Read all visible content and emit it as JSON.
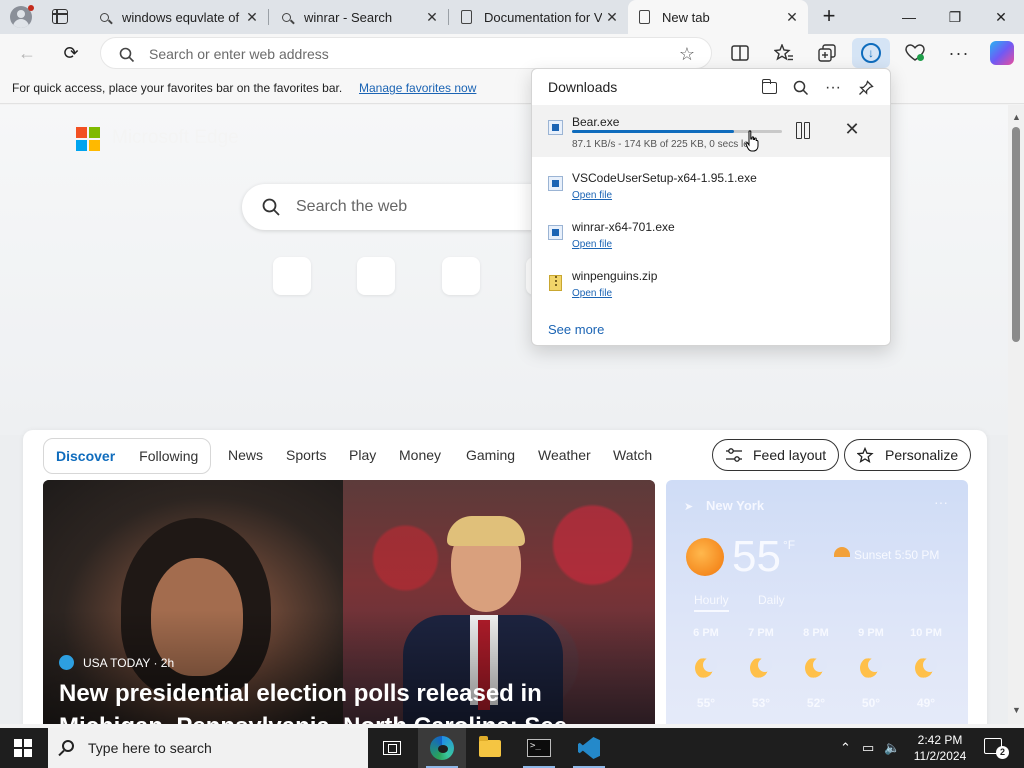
{
  "browser": {
    "tabs": [
      {
        "title": "windows equvlate of b",
        "icon": "search-icon"
      },
      {
        "title": "winrar - Search",
        "icon": "search-icon"
      },
      {
        "title": "Documentation for Vi",
        "icon": "document-icon"
      },
      {
        "title": "New tab",
        "icon": "document-icon",
        "active": true
      }
    ],
    "new_tab": "+",
    "close_glyph": "✕",
    "window": {
      "minimize": "—",
      "restore": "❐",
      "close": "✕"
    }
  },
  "address_bar": {
    "placeholder": "Search or enter web address",
    "value": ""
  },
  "favorites_bar": {
    "message": "For quick access, place your favorites bar on the favorites bar.",
    "link": "Manage favorites now"
  },
  "newtab": {
    "brand": "Microsoft Edge",
    "search_placeholder": "Search the web",
    "quick_links_count": 4
  },
  "downloads": {
    "title": "Downloads",
    "see_more": "See more",
    "items": [
      {
        "name": "Bear.exe",
        "status": "87.1 KB/s - 174 KB of 225 KB, 0 secs left",
        "progress": 0.77,
        "type": "exe",
        "in_progress": true
      },
      {
        "name": "VSCodeUserSetup-x64-1.95.1.exe",
        "action": "Open file",
        "type": "exe"
      },
      {
        "name": "winrar-x64-701.exe",
        "action": "Open file",
        "type": "exe"
      },
      {
        "name": "winpenguins.zip",
        "action": "Open file",
        "type": "zip"
      }
    ]
  },
  "feed": {
    "tabs": [
      "Discover",
      "Following"
    ],
    "selected_tab": "Discover",
    "nav": [
      "News",
      "Sports",
      "Play",
      "Money",
      "Gaming",
      "Weather",
      "Watch"
    ],
    "feed_layout": "Feed layout",
    "personalize": "Personalize",
    "hero": {
      "source": "USA TODAY · 2h",
      "headline": "New presidential election polls released in Michigan, Pennsylvania, North Carolina: See results"
    }
  },
  "weather": {
    "location": "New York",
    "temp": "55",
    "unit": "°F",
    "sunset": "Sunset 5:50 PM",
    "tabs": [
      "Hourly",
      "Daily"
    ],
    "hours": [
      "6 PM",
      "7 PM",
      "8 PM",
      "9 PM",
      "10 PM"
    ],
    "temps": [
      "55°",
      "53°",
      "52°",
      "50°",
      "49°"
    ]
  },
  "taskbar": {
    "search_placeholder": "Type here to search",
    "time": "2:42 PM",
    "date": "11/2/2024",
    "notification_count": "2"
  },
  "colors": {
    "accent": "#0f6cbd",
    "link": "#1b64b4",
    "ms_red": "#f25022",
    "ms_green": "#7fba00",
    "ms_blue": "#00a4ef",
    "ms_yellow": "#ffb900"
  }
}
